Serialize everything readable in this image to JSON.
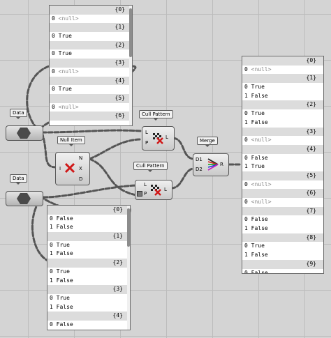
{
  "data_params": [
    {
      "label": "Data"
    },
    {
      "label": "Data"
    }
  ],
  "null_item": {
    "title": "Null Item",
    "inputs": [
      "I"
    ],
    "outputs": [
      "N",
      "X",
      "D"
    ]
  },
  "cull_pattern_1": {
    "title": "Cull Pattern",
    "inputs": [
      "L",
      "P"
    ],
    "outputs": [
      "L"
    ]
  },
  "cull_pattern_2": {
    "title": "Cull Pattern",
    "inputs": [
      "L",
      "P"
    ],
    "outputs": [
      "L"
    ]
  },
  "merge": {
    "title": "Merge",
    "inputs": [
      "D1",
      "D2"
    ],
    "outputs": [
      "R"
    ]
  },
  "panel_top": {
    "rows": [
      {
        "hdr": "{0}"
      },
      {
        "idx": "0",
        "val": "<null>",
        "null": true
      },
      {
        "hdr": "{1}"
      },
      {
        "idx": "0",
        "val": "True"
      },
      {
        "hdr": "{2}"
      },
      {
        "idx": "0",
        "val": "True"
      },
      {
        "hdr": "{3}"
      },
      {
        "idx": "0",
        "val": "<null>",
        "null": true
      },
      {
        "hdr": "{4}"
      },
      {
        "idx": "0",
        "val": "True"
      },
      {
        "hdr": "{5}"
      },
      {
        "idx": "0",
        "val": "<null>",
        "null": true
      },
      {
        "hdr": "{6}"
      }
    ]
  },
  "panel_bottom": {
    "rows": [
      {
        "hdr": "{0}"
      },
      {
        "idx": "0",
        "val": "False"
      },
      {
        "idx": "1",
        "val": "False"
      },
      {
        "hdr": "{1}"
      },
      {
        "idx": "0",
        "val": "True"
      },
      {
        "idx": "1",
        "val": "False"
      },
      {
        "hdr": "{2}"
      },
      {
        "idx": "0",
        "val": "True"
      },
      {
        "idx": "1",
        "val": "False"
      },
      {
        "hdr": "{3}"
      },
      {
        "idx": "0",
        "val": "True"
      },
      {
        "idx": "1",
        "val": "False"
      },
      {
        "hdr": "{4}"
      },
      {
        "idx": "0",
        "val": "False"
      }
    ]
  },
  "panel_right": {
    "rows": [
      {
        "hdr": "{0}"
      },
      {
        "idx": "0",
        "val": "<null>",
        "null": true
      },
      {
        "hdr": "{1}"
      },
      {
        "idx": "0",
        "val": "True"
      },
      {
        "idx": "1",
        "val": "False"
      },
      {
        "hdr": "{2}"
      },
      {
        "idx": "0",
        "val": "True"
      },
      {
        "idx": "1",
        "val": "False"
      },
      {
        "hdr": "{3}"
      },
      {
        "idx": "0",
        "val": "<null>",
        "null": true
      },
      {
        "hdr": "{4}"
      },
      {
        "idx": "0",
        "val": "False"
      },
      {
        "idx": "1",
        "val": "True"
      },
      {
        "hdr": "{5}"
      },
      {
        "idx": "0",
        "val": "<null>",
        "null": true
      },
      {
        "hdr": "{6}"
      },
      {
        "idx": "0",
        "val": "<null>",
        "null": true
      },
      {
        "hdr": "{7}"
      },
      {
        "idx": "0",
        "val": "False"
      },
      {
        "idx": "1",
        "val": "False"
      },
      {
        "hdr": "{8}"
      },
      {
        "idx": "0",
        "val": "True"
      },
      {
        "idx": "1",
        "val": "False"
      },
      {
        "hdr": "{9}"
      },
      {
        "idx": "0",
        "val": "False"
      }
    ]
  }
}
